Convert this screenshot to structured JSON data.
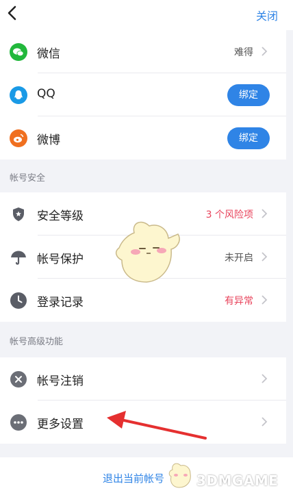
{
  "nav": {
    "close_label": "关闭"
  },
  "bindings": [
    {
      "label": "微信",
      "value": "难得",
      "icon": "wechat-icon",
      "color": "#22b83c"
    },
    {
      "label": "QQ",
      "button": "绑定",
      "icon": "qq-icon",
      "color": "#1a9ae6"
    },
    {
      "label": "微博",
      "button": "绑定",
      "icon": "weibo-icon",
      "color": "#f07020"
    }
  ],
  "security": {
    "header": "帐号安全",
    "items": [
      {
        "label": "安全等级",
        "value": "3 个风险项",
        "icon": "shield-icon"
      },
      {
        "label": "帐号保护",
        "value": "未开启",
        "icon": "umbrella-icon"
      },
      {
        "label": "登录记录",
        "value": "有异常",
        "icon": "clock-icon"
      }
    ]
  },
  "advanced": {
    "header": "帐号高级功能",
    "items": [
      {
        "label": "帐号注销",
        "icon": "cancel-circle-icon"
      },
      {
        "label": "更多设置",
        "icon": "more-dots-icon"
      }
    ]
  },
  "logout_label": "退出当前帐号",
  "watermark": "3DMGAME",
  "colors": {
    "accent": "#2f84e6",
    "warning": "#e8435b"
  }
}
